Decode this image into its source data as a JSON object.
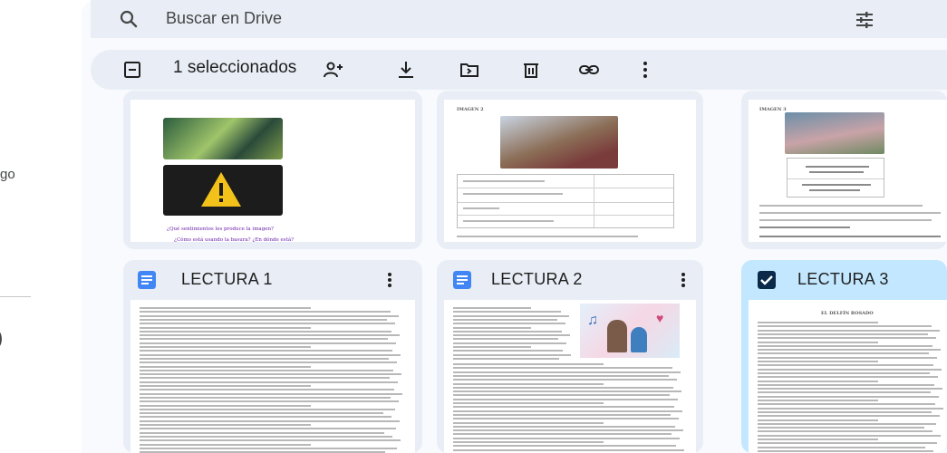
{
  "left": {
    "text_fragment": "go",
    "paren": ")"
  },
  "search": {
    "placeholder": "Buscar en Drive"
  },
  "selection_bar": {
    "count_label": "1 seleccionados"
  },
  "cards_top": [
    {
      "caption_1": "¿Qué sentimientos les produce la imagen?",
      "caption_2": "¿Cómo está usando la basura? ¿En dónde está?"
    },
    {
      "heading": "IMAGEN 2"
    },
    {
      "heading": "IMAGEN 3"
    }
  ],
  "files": [
    {
      "name": "LECTURA 1",
      "icon": "docs-icon"
    },
    {
      "name": "LECTURA 2",
      "icon": "docs-icon"
    },
    {
      "name": "LECTURA 3",
      "icon": "checkbox-checked-icon",
      "page_heading": "EL DELFÍN ROSADO"
    }
  ],
  "colors": {
    "accent": "#4285f4",
    "selected": "#c2e7ff",
    "surface": "#e9eef6"
  }
}
